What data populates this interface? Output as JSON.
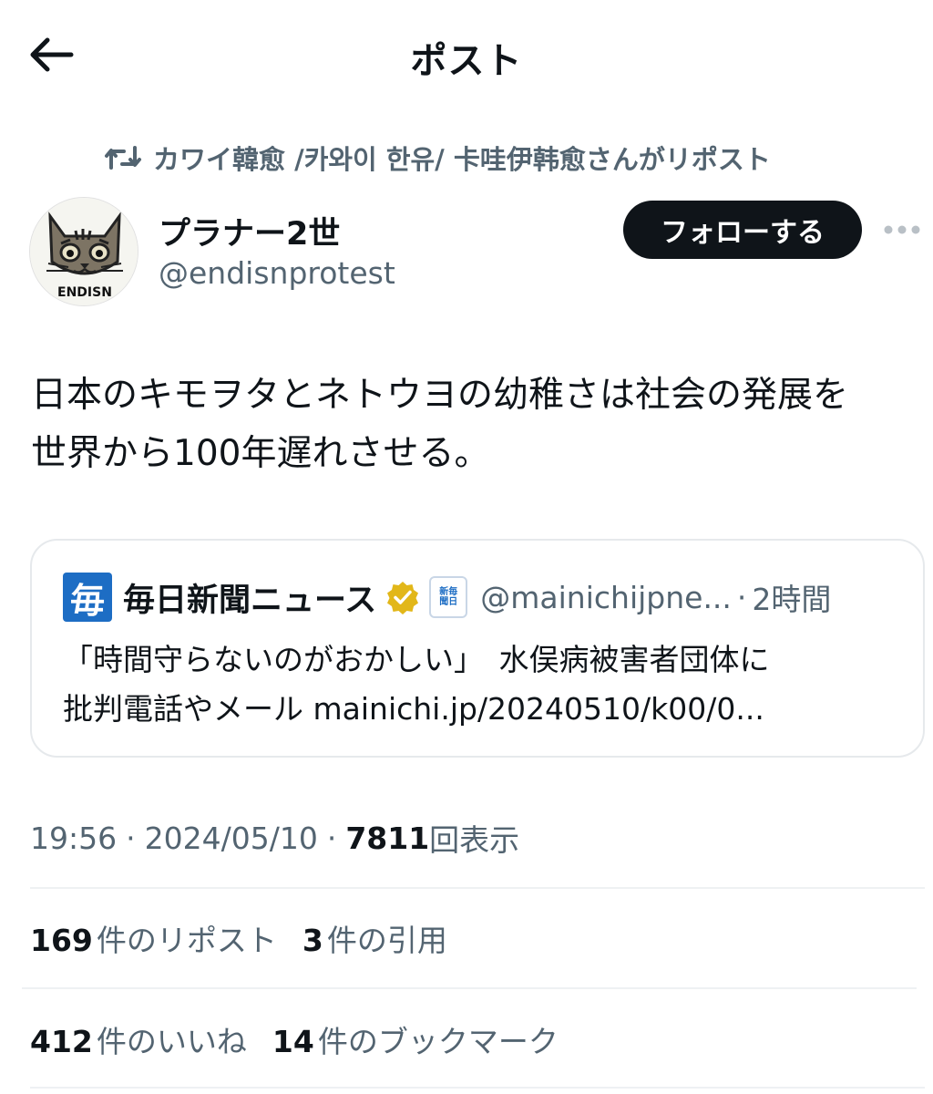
{
  "header": {
    "title": "ポスト"
  },
  "repost": {
    "text": "カワイ韓愈 /카와이 한유/ 卡哇伊韩愈さんがリポスト"
  },
  "author": {
    "display_name": "プラナー2世",
    "handle": "@endisnprotest",
    "avatar_text": "ENDISN"
  },
  "follow_button": {
    "label": "フォローする"
  },
  "post": {
    "lines": [
      "日本のキモヲタとネトウヨの幼稚さは社会の発展を",
      "世界から100年遅れさせる。"
    ]
  },
  "quote": {
    "logo_text": "毎",
    "name": "毎日新聞ニュース",
    "handle": "@mainichijpne...",
    "separator": "·",
    "time": "2時間",
    "lines": [
      "「時間守らないのがおかしい」　水俣病被害者団体に",
      "批判電話やメール mainichi.jp/20240510/k00/0..."
    ],
    "affiliate_lines": [
      "新毎",
      "聞日"
    ]
  },
  "meta": {
    "time": "19:56",
    "sep1": "·",
    "date": "2024/05/10",
    "sep2": "·",
    "views": "7811",
    "views_label": "回表示"
  },
  "stats_row1": {
    "reposts": "169",
    "reposts_label": "件のリポスト",
    "quotes": "3",
    "quotes_label": "件の引用"
  },
  "stats_row2": {
    "likes": "412",
    "likes_label": "件のいいね",
    "bookmarks": "14",
    "bookmarks_label": "件のブックマーク"
  },
  "colors": {
    "text": "#0f1419",
    "secondary": "#536471",
    "brand_blue": "#1d6dc4",
    "verified_gold": "#e2b719"
  }
}
